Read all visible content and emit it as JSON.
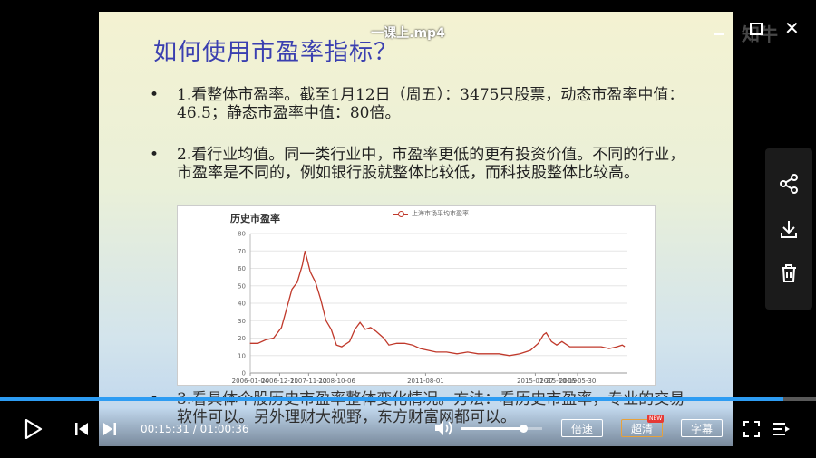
{
  "video": {
    "title": "一课上.mp4",
    "watermark": "知牛",
    "current_time": "00:15:31",
    "separator": " / ",
    "total_time": "01:00:36",
    "progress": 0.96,
    "volume": 0.77
  },
  "slide": {
    "title": "如何使用市盈率指标？",
    "bullets": [
      {
        "mark": "•",
        "text": "1.看整体市盈率。截至1月12日（周五）：3475只股票，动态市盈率中值：46.5；静态市盈率中值：80倍。"
      },
      {
        "mark": "•",
        "text": "2.看行业均值。同一类行业中，市盈率更低的更有投资价值。不同的行业，市盈率是不同的，例如银行股就整体比较低，而科技股整体比较高。"
      },
      {
        "mark": "•",
        "text": "3.看具体个股历史市盈率整体变化情况。方法：看历史市盈率，专业的交易软件可以。另外理财大视野，东方财富网都可以。"
      }
    ]
  },
  "controls": {
    "speed_label": "倍速",
    "quality_label": "超清",
    "quality_badge": "NEW",
    "subtitle_label": "字幕"
  },
  "colors": {
    "accent": "#2d9cf3",
    "series": "#c0392b",
    "title": "#3a3fb0"
  },
  "icons": [
    "play-icon",
    "prev-icon",
    "next-icon",
    "volume-icon",
    "fullscreen-icon",
    "playlist-icon",
    "share-icon",
    "download-icon",
    "delete-icon",
    "minimize-icon",
    "maximize-icon",
    "close-icon"
  ],
  "chart_data": {
    "type": "line",
    "title": "历史市盈率",
    "legend": "上海市场平均市盈率",
    "legend_position": "top-center",
    "grid": true,
    "ylim": [
      0,
      80
    ],
    "yticks": [
      0,
      10,
      20,
      30,
      40,
      50,
      60,
      70,
      80
    ],
    "xlim": [
      "2006-01-04",
      "2017-12-31"
    ],
    "xticks": [
      "2006-01-04",
      "2006-12-11",
      "2007-11-12",
      "2008-10-06",
      "2011-08-01",
      "2015-01-27",
      "2015-10-19",
      "2016-05-30"
    ],
    "series": [
      {
        "name": "上海市场平均市盈率",
        "points": [
          [
            "2006-01",
            17
          ],
          [
            "2006-04",
            17
          ],
          [
            "2006-07",
            19
          ],
          [
            "2006-10",
            20
          ],
          [
            "2007-01",
            26
          ],
          [
            "2007-03",
            37
          ],
          [
            "2007-05",
            48
          ],
          [
            "2007-07",
            52
          ],
          [
            "2007-09",
            62
          ],
          [
            "2007-10",
            70
          ],
          [
            "2007-12",
            58
          ],
          [
            "2008-02",
            52
          ],
          [
            "2008-04",
            42
          ],
          [
            "2008-06",
            30
          ],
          [
            "2008-08",
            25
          ],
          [
            "2008-10",
            16
          ],
          [
            "2008-12",
            15
          ],
          [
            "2009-03",
            18
          ],
          [
            "2009-05",
            25
          ],
          [
            "2009-07",
            29
          ],
          [
            "2009-09",
            25
          ],
          [
            "2009-11",
            26
          ],
          [
            "2010-01",
            24
          ],
          [
            "2010-04",
            20
          ],
          [
            "2010-06",
            16
          ],
          [
            "2010-09",
            17
          ],
          [
            "2010-12",
            17
          ],
          [
            "2011-03",
            16
          ],
          [
            "2011-06",
            14
          ],
          [
            "2011-09",
            13
          ],
          [
            "2011-12",
            12
          ],
          [
            "2012-04",
            12
          ],
          [
            "2012-08",
            11
          ],
          [
            "2012-12",
            12
          ],
          [
            "2013-04",
            11
          ],
          [
            "2013-08",
            11
          ],
          [
            "2013-12",
            11
          ],
          [
            "2014-04",
            10
          ],
          [
            "2014-08",
            11
          ],
          [
            "2014-12",
            13
          ],
          [
            "2015-03",
            17
          ],
          [
            "2015-05",
            22
          ],
          [
            "2015-06",
            23
          ],
          [
            "2015-08",
            18
          ],
          [
            "2015-10",
            16
          ],
          [
            "2015-12",
            18
          ],
          [
            "2016-03",
            15
          ],
          [
            "2016-06",
            15
          ],
          [
            "2016-09",
            15
          ],
          [
            "2016-12",
            15
          ],
          [
            "2017-03",
            15
          ],
          [
            "2017-06",
            14
          ],
          [
            "2017-09",
            15
          ],
          [
            "2017-11",
            16
          ],
          [
            "2017-12",
            15
          ]
        ]
      }
    ]
  }
}
